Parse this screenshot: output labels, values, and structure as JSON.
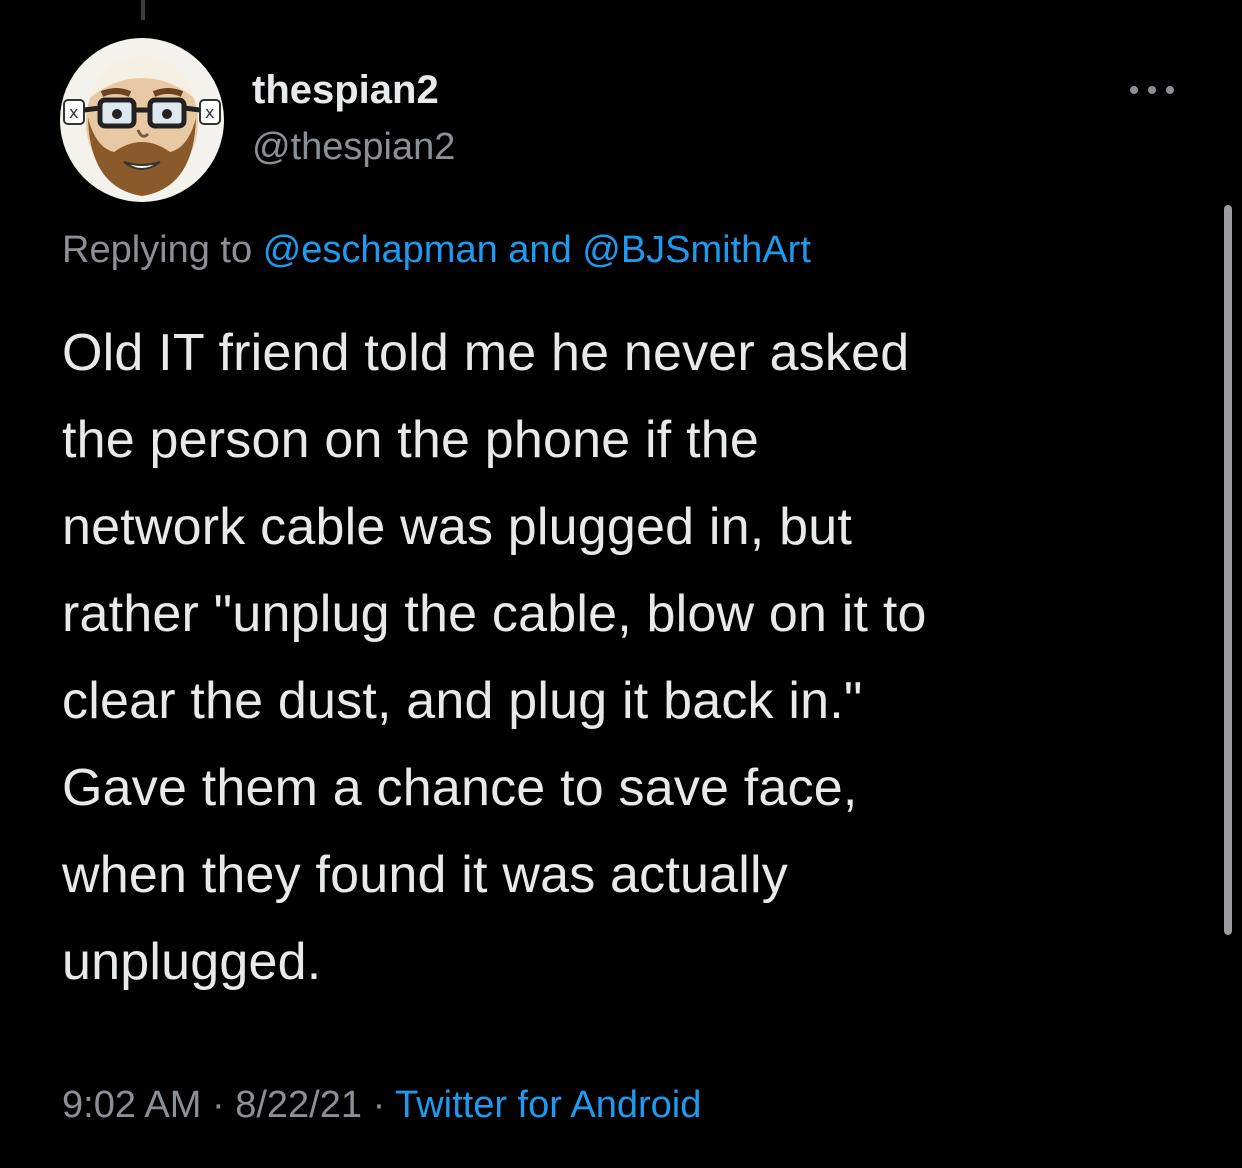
{
  "tweet": {
    "author": {
      "display_name": "thespian2",
      "handle": "@thespian2",
      "avatar_icon": "cartoon-bearded-man-with-glasses-avatar"
    },
    "more_icon": "more-horizontal-icon",
    "reply_context": {
      "prefix": "Replying to",
      "mention_1": "@eschapman",
      "conjunction": "and",
      "mention_2": "@BJSmithArt"
    },
    "text_lines": [
      "Old IT friend told me he never asked",
      "the person on the phone if the",
      "network cable was plugged in, but",
      "rather \"unplug the cable, blow on it to",
      "clear the dust, and plug it back in.\"",
      "Gave them a chance to save face,",
      "when they found it was actually",
      "unplugged."
    ],
    "meta": {
      "time": "9:02 AM",
      "separator": "·",
      "date": "8/22/21",
      "source": "Twitter for Android"
    }
  },
  "colors": {
    "background": "#000000",
    "text_primary": "#e7e9ea",
    "text_secondary": "#8b9096",
    "link": "#1d9bf0"
  }
}
